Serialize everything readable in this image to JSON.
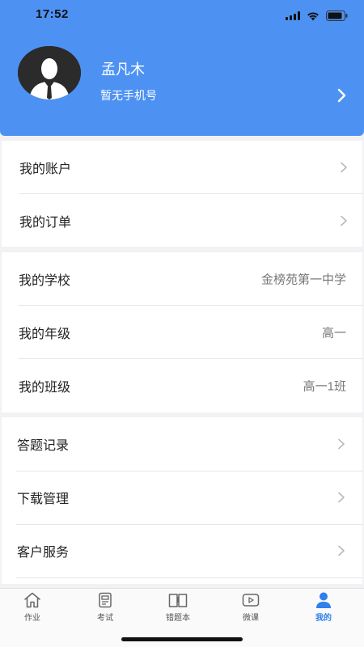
{
  "status_bar": {
    "time": "17:52"
  },
  "profile": {
    "name": "孟凡木",
    "phone": "暂无手机号"
  },
  "account_section": [
    {
      "label": "我的账户",
      "name": "row-my-account"
    },
    {
      "label": "我的订单",
      "name": "row-my-orders"
    }
  ],
  "school_section": [
    {
      "label": "我的学校",
      "value": "金榜苑第一中学"
    },
    {
      "label": "我的年级",
      "value": "高一"
    },
    {
      "label": "我的班级",
      "value": "高一1班"
    }
  ],
  "service_section": [
    {
      "label": "答题记录"
    },
    {
      "label": "下载管理"
    },
    {
      "label": "客户服务"
    }
  ],
  "tab_bar": {
    "tabs": [
      {
        "label": "作业",
        "icon": "home-icon"
      },
      {
        "label": "考试",
        "icon": "exam-icon"
      },
      {
        "label": "错题本",
        "icon": "notebook-icon"
      },
      {
        "label": "微课",
        "icon": "video-icon"
      },
      {
        "label": "我的",
        "icon": "profile-icon",
        "active": true
      }
    ]
  },
  "colors": {
    "header": "#4d92f3",
    "active_tab": "#2f80ed"
  }
}
